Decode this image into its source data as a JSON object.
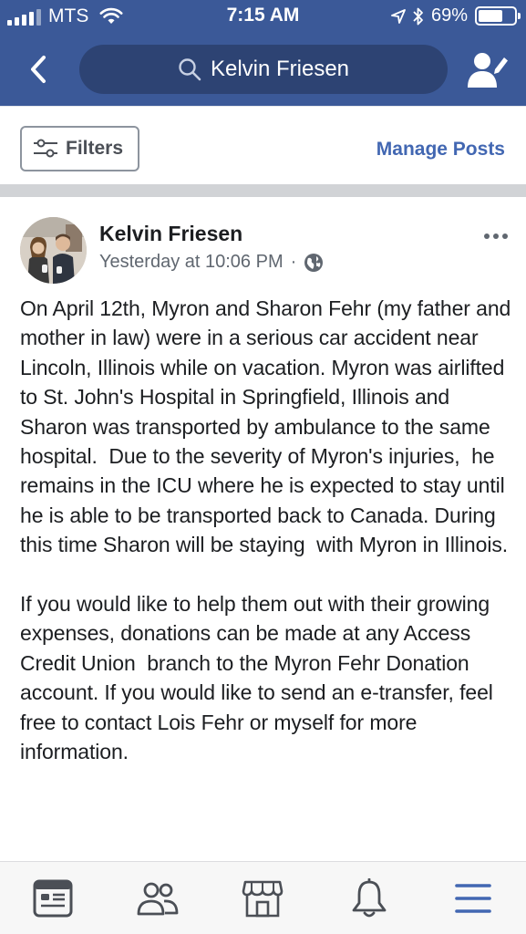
{
  "status_bar": {
    "carrier": "MTS",
    "time": "7:15 AM",
    "battery": "69%",
    "battery_level": 0.69
  },
  "search": {
    "query": "Kelvin Friesen"
  },
  "filters": {
    "filters_label": "Filters",
    "manage_label": "Manage Posts"
  },
  "post": {
    "author": "Kelvin Friesen",
    "timestamp": "Yesterday at 10:06 PM",
    "separator": "·",
    "privacy_icon": "globe-icon",
    "body": "On April 12th, Myron and Sharon Fehr (my father and mother in law) were in a serious car accident near Lincoln, Illinois while on vacation. Myron was airlifted to St. John's Hospital in Springfield, Illinois and Sharon was transported by ambulance to the same hospital.  Due to the severity of Myron's injuries,  he remains in the ICU where he is expected to stay until he is able to be transported back to Canada. During this time Sharon will be staying  with Myron in Illinois.\n\nIf you would like to help them out with their growing expenses, donations can be made at any Access Credit Union  branch to the Myron Fehr Donation account. If you would like to send an e-transfer, feel free to contact Lois Fehr or myself for more information."
  },
  "tabbar": {
    "tabs": [
      "news-feed-icon",
      "friends-icon",
      "marketplace-icon",
      "notifications-icon",
      "menu-icon"
    ],
    "active_tab": "menu-icon"
  },
  "colors": {
    "header_blue": "#3b5998",
    "search_blue": "#2d4373",
    "link_blue": "#4267b2",
    "active_tab": "#4267b2",
    "inactive_tab": "#4b4f56"
  }
}
